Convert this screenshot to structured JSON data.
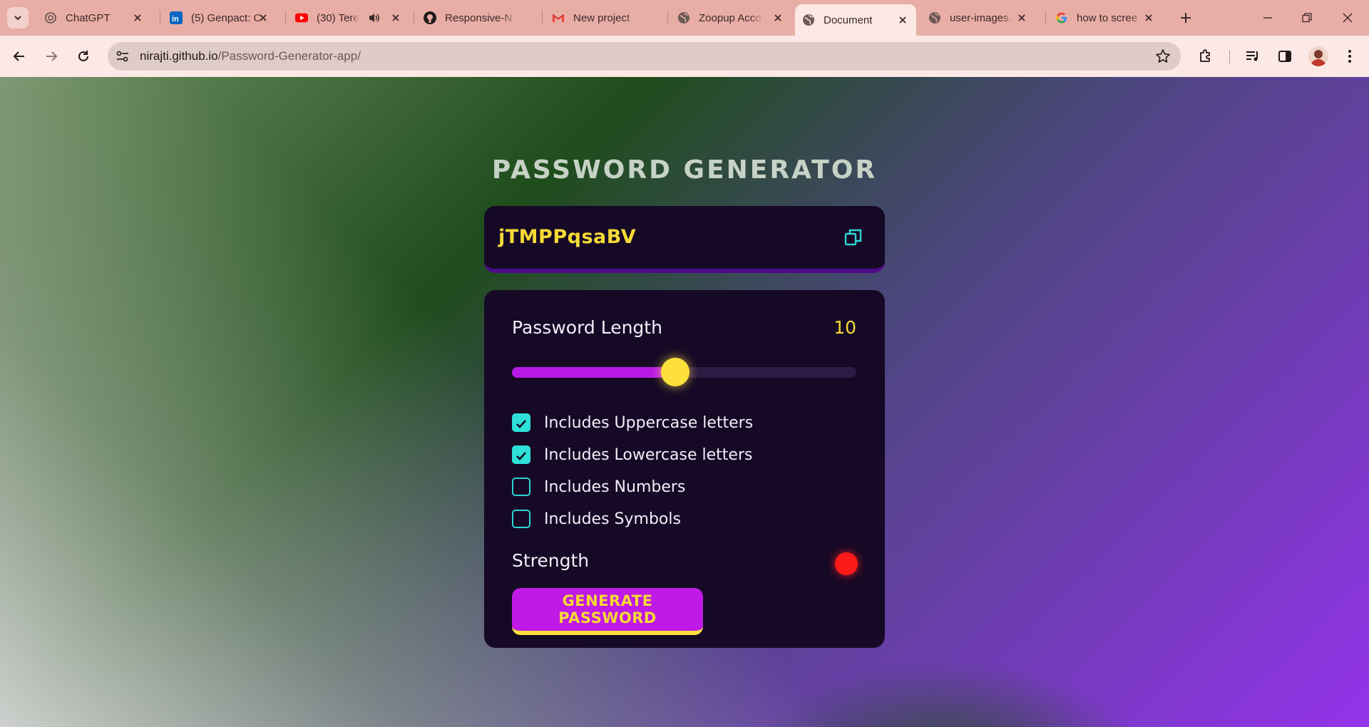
{
  "browser": {
    "tabs": [
      {
        "title": "ChatGPT",
        "favicon": "chatgpt-icon",
        "active": false
      },
      {
        "title": "(5) Genpact: C",
        "favicon": "linkedin-icon",
        "active": false
      },
      {
        "title": "(30) Tere",
        "favicon": "youtube-icon",
        "active": false,
        "audio": true
      },
      {
        "title": "Responsive-N",
        "favicon": "github-icon",
        "active": false
      },
      {
        "title": "New project",
        "favicon": "gmail-icon",
        "active": false
      },
      {
        "title": "Zoopup Acco",
        "favicon": "globe-icon",
        "active": false
      },
      {
        "title": "Document",
        "favicon": "globe-icon",
        "active": true
      },
      {
        "title": "user-images.",
        "favicon": "globe-icon",
        "active": false
      },
      {
        "title": "how to scree",
        "favicon": "google-icon",
        "active": false
      }
    ],
    "url_host": "nirajti.github.io",
    "url_path": "/Password-Generator-app/"
  },
  "app": {
    "title": "PASSWORD GENERATOR",
    "password": "jTMPPqsaBV",
    "length_label": "Password Length",
    "length_value": "10",
    "slider": {
      "min": 1,
      "max": 20,
      "value": 10
    },
    "options": [
      {
        "label": "Includes Uppercase letters",
        "checked": true
      },
      {
        "label": "Includes Lowercase letters",
        "checked": true
      },
      {
        "label": "Includes Numbers",
        "checked": false
      },
      {
        "label": "Includes Symbols",
        "checked": false
      }
    ],
    "strength_label": "Strength",
    "strength_color": "#ff1a1a",
    "generate_label": "GENERATE PASSWORD"
  },
  "colors": {
    "accent_yellow": "#f5d935",
    "accent_purple": "#c01ae6",
    "checkbox_teal": "#2ee0d8",
    "panel_bg": "#160926"
  }
}
